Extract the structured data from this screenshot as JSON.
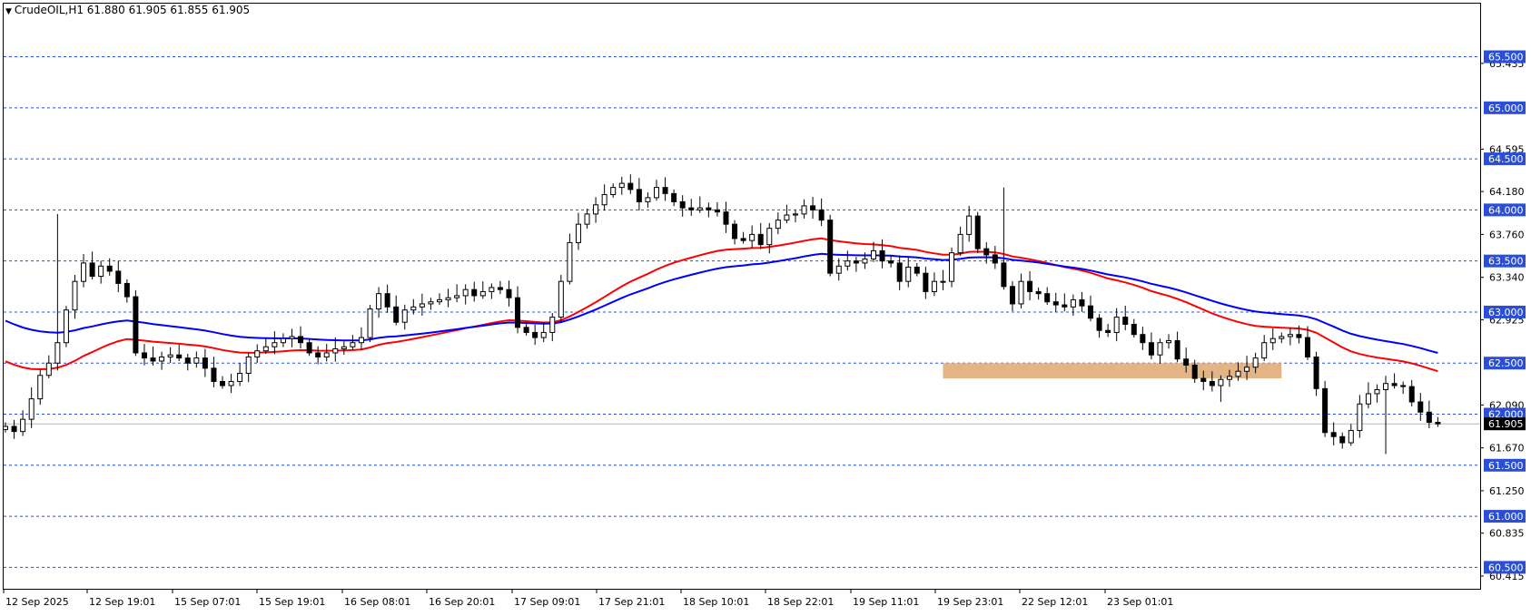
{
  "window": {
    "title": "CrudeOIL,H1  61.880 61.905 61.855 61.905",
    "dropdown_icon": "triangle-down-icon"
  },
  "chart_data": {
    "type": "candlestick",
    "symbol": "CrudeOIL",
    "timeframe": "H1",
    "ohlc_header": {
      "open": 61.88,
      "high": 61.905,
      "low": 61.855,
      "close": 61.905
    },
    "current_price": "61.905",
    "ylim": [
      60.29,
      66.02
    ],
    "price_scale_labels": [
      "65.435",
      "64.595",
      "64.180",
      "63.760",
      "63.340",
      "62.925",
      "62.090",
      "61.670",
      "61.250",
      "60.835",
      "60.415"
    ],
    "level_labels": [
      "65.500",
      "65.000",
      "64.500",
      "64.000",
      "63.500",
      "63.000",
      "62.500",
      "62.000",
      "61.500",
      "61.000",
      "60.500"
    ],
    "levels": [
      65.5,
      65.0,
      64.5,
      64.0,
      63.5,
      63.0,
      62.5,
      62.0,
      61.5,
      61.0,
      60.5
    ],
    "time_labels": [
      "12 Sep 2025",
      "12 Sep 19:01",
      "15 Sep 07:01",
      "15 Sep 19:01",
      "16 Sep 08:01",
      "16 Sep 20:01",
      "17 Sep 09:01",
      "17 Sep 21:01",
      "18 Sep 10:01",
      "18 Sep 22:01",
      "19 Sep 11:01",
      "19 Sep 23:01",
      "22 Sep 12:01",
      "23 Sep 01:01"
    ],
    "zone": {
      "price_low": 62.35,
      "price_high": 62.5,
      "start_index": 108,
      "end_index": 147
    },
    "close": [
      61.88,
      61.83,
      61.95,
      62.15,
      62.38,
      62.5,
      62.7,
      63.02,
      63.3,
      63.48,
      63.35,
      63.45,
      63.4,
      63.28,
      63.15,
      62.6,
      62.55,
      62.52,
      62.56,
      62.58,
      62.55,
      62.5,
      62.55,
      62.45,
      62.32,
      62.28,
      62.32,
      62.4,
      62.56,
      62.62,
      62.66,
      62.7,
      62.74,
      62.76,
      62.7,
      62.6,
      62.56,
      62.6,
      62.64,
      62.66,
      62.7,
      62.75,
      63.03,
      63.18,
      63.05,
      62.9,
      63.02,
      63.05,
      63.08,
      63.1,
      63.12,
      63.14,
      63.16,
      63.22,
      63.16,
      63.2,
      63.24,
      63.22,
      63.14,
      62.85,
      62.8,
      62.75,
      62.8,
      62.95,
      63.3,
      63.68,
      63.86,
      63.96,
      64.05,
      64.15,
      64.22,
      64.26,
      64.2,
      64.08,
      64.12,
      64.22,
      64.16,
      64.08,
      64.02,
      64.0,
      64.02,
      64.0,
      63.98,
      63.86,
      63.72,
      63.7,
      63.76,
      63.66,
      63.82,
      63.9,
      63.95,
      63.96,
      64.04,
      64.0,
      63.9,
      63.38,
      63.45,
      63.5,
      63.48,
      63.52,
      63.6,
      63.5,
      63.48,
      63.3,
      63.44,
      63.38,
      63.2,
      63.3,
      63.3,
      63.58,
      63.76,
      63.94,
      63.62,
      63.56,
      63.48,
      63.25,
      63.08,
      63.3,
      63.2,
      63.18,
      63.1,
      63.07,
      63.05,
      63.12,
      63.06,
      62.94,
      62.82,
      62.8,
      62.95,
      62.88,
      62.78,
      62.7,
      62.58,
      62.7,
      62.72,
      62.54,
      62.48,
      62.35,
      62.32,
      62.28,
      62.34,
      62.37,
      62.42,
      62.46,
      62.55,
      62.7,
      62.74,
      62.76,
      62.78,
      62.75,
      62.56,
      62.25,
      61.82,
      61.78,
      61.72,
      61.84,
      62.1,
      62.2,
      62.24,
      62.3,
      62.28,
      62.27,
      62.12,
      62.02,
      61.92,
      61.905
    ],
    "ema_fast": {
      "name": "EMA (red)",
      "color": "#ff0000"
    },
    "ema_slow": {
      "name": "EMA (blue)",
      "color": "#0000ff"
    },
    "zone_color": "#e3b584",
    "level_line_color": "#2a4fd6"
  }
}
